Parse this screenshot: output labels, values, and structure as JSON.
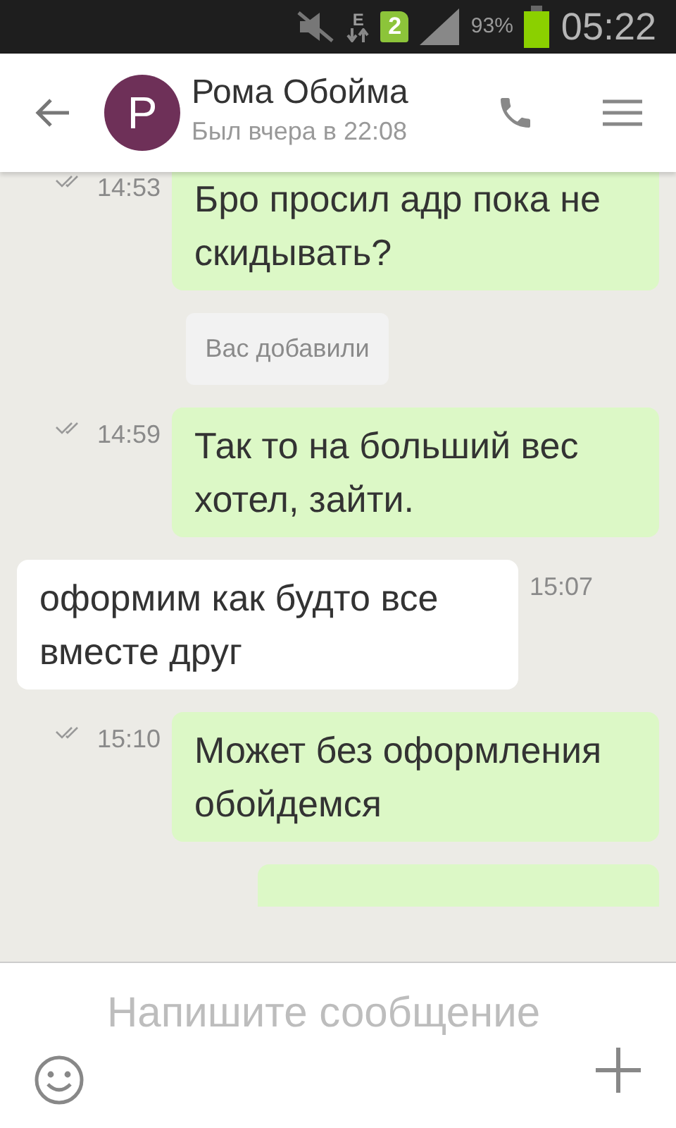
{
  "status_bar": {
    "network": "E",
    "sim": "2",
    "battery": "93%",
    "time": "05:22"
  },
  "header": {
    "avatar_letter": "P",
    "name": "Рома Обойма",
    "last_seen": "Был вчера в 22:08"
  },
  "messages": [
    {
      "kind": "outgoing",
      "text": "Бро просил адр пока не скидывать?",
      "time": "14:53"
    },
    {
      "kind": "system",
      "text": "Вас добавили"
    },
    {
      "kind": "outgoing",
      "text": "Так то на больший вес хотел, зайти.",
      "time": "14:59"
    },
    {
      "kind": "incoming",
      "text": "оформим как будто все вместе друг",
      "time": "15:07"
    },
    {
      "kind": "outgoing",
      "text": "Может без оформления обойдемся",
      "time": "15:10"
    },
    {
      "kind": "outgoing_cut"
    }
  ],
  "composer": {
    "placeholder": "Напишите сообщение"
  }
}
